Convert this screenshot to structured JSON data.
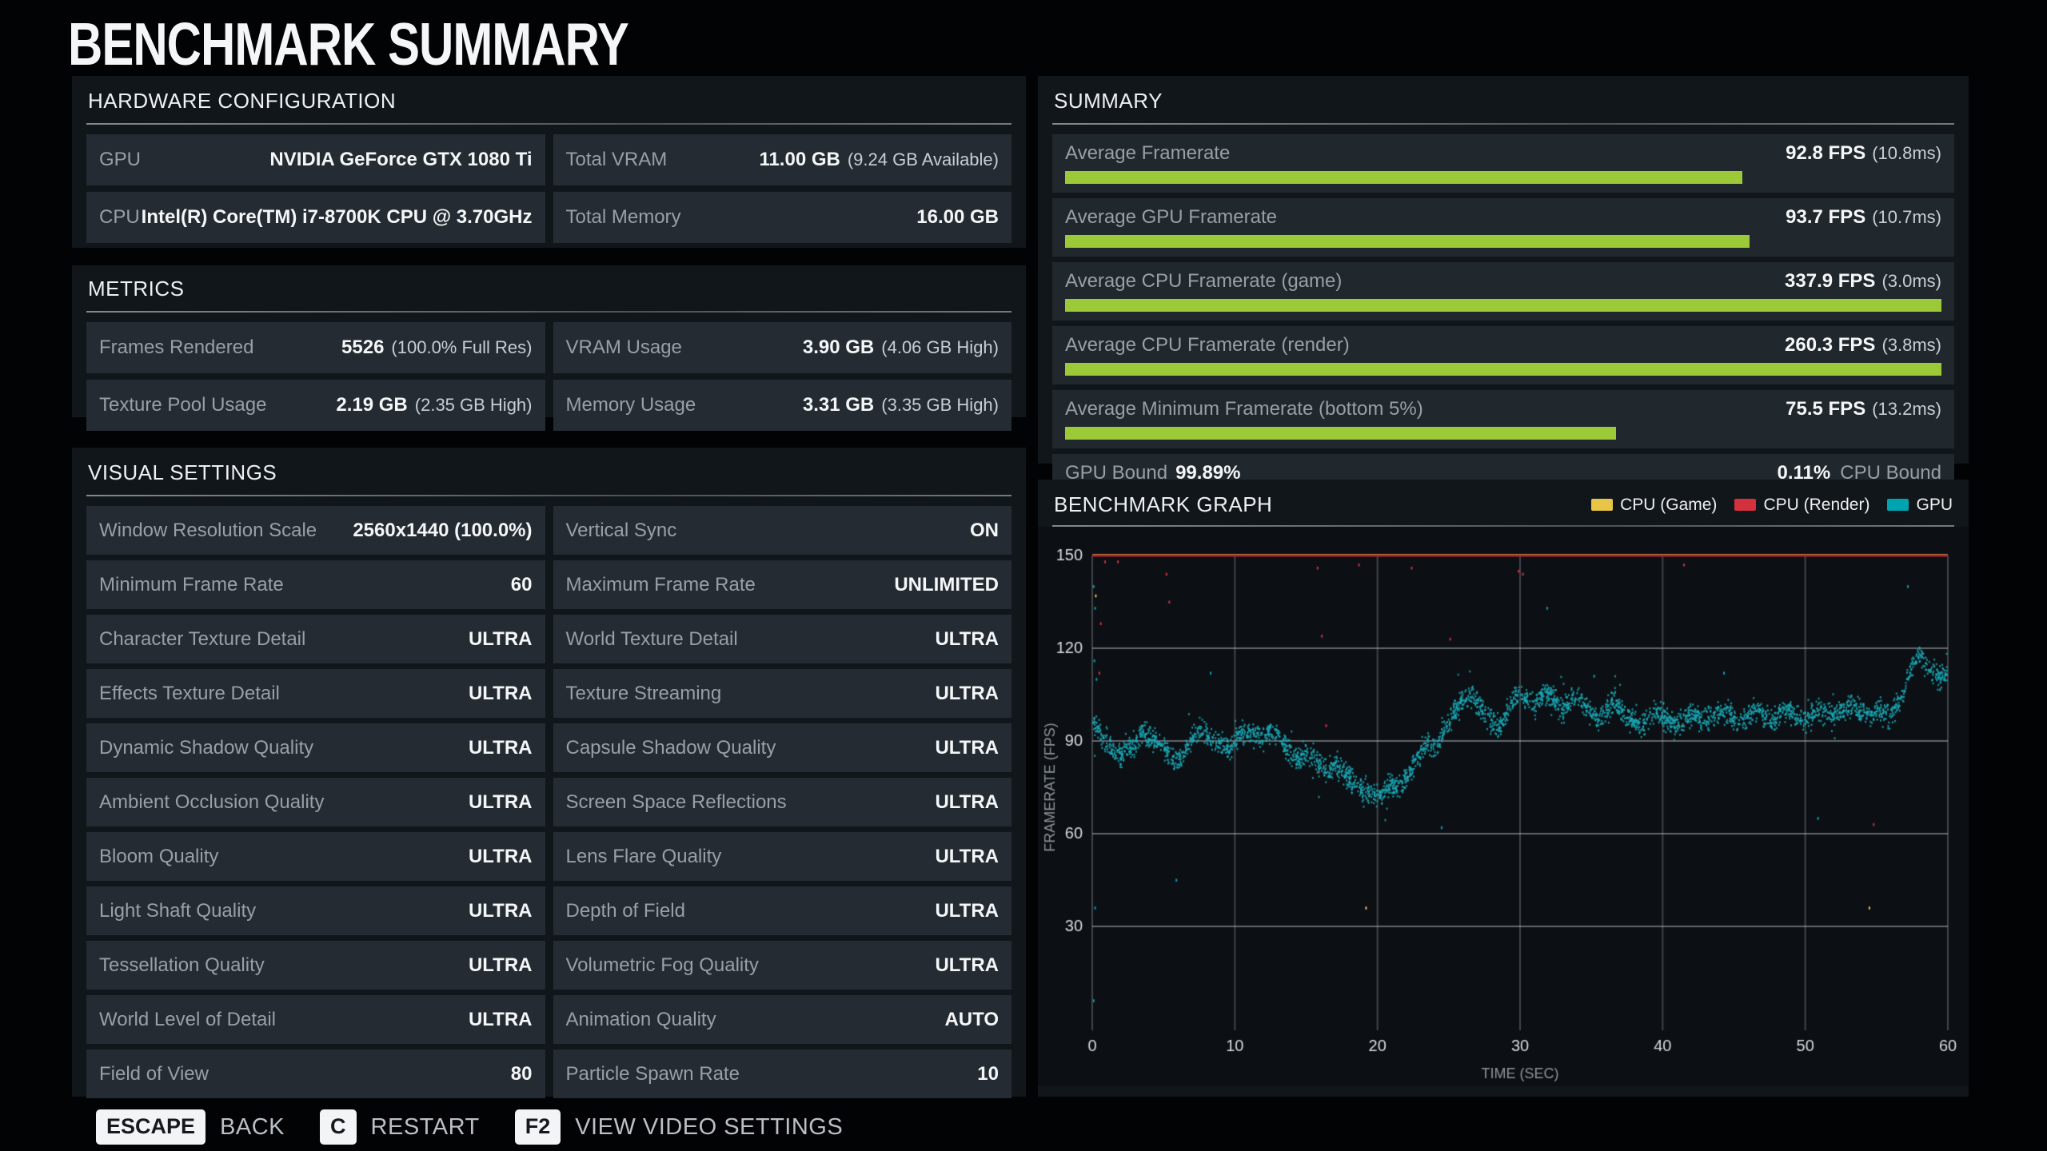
{
  "title": "BENCHMARK SUMMARY",
  "colors": {
    "green": "#9cc938",
    "cyan": "#00a3b0",
    "red": "#c2303c",
    "yellow": "#e8c547",
    "scatter_teal": "#1aa9b6",
    "red_line": "#a92733"
  },
  "hardware": {
    "heading": "HARDWARE CONFIGURATION",
    "rows": [
      {
        "label": "GPU",
        "value": "NVIDIA GeForce GTX 1080 Ti",
        "note": ""
      },
      {
        "label": "Total VRAM",
        "value": "11.00 GB",
        "note": "(9.24 GB Available)"
      },
      {
        "label": "CPU",
        "value": "Intel(R) Core(TM) i7-8700K CPU @ 3.70GHz",
        "note": ""
      },
      {
        "label": "Total Memory",
        "value": "16.00 GB",
        "note": ""
      }
    ]
  },
  "metrics": {
    "heading": "METRICS",
    "rows": [
      {
        "label": "Frames Rendered",
        "value": "5526",
        "note": "(100.0% Full Res)"
      },
      {
        "label": "VRAM Usage",
        "value": "3.90 GB",
        "note": "(4.06 GB High)"
      },
      {
        "label": "Texture Pool Usage",
        "value": "2.19 GB",
        "note": "(2.35 GB High)"
      },
      {
        "label": "Memory Usage",
        "value": "3.31 GB",
        "note": "(3.35 GB High)"
      }
    ]
  },
  "settings": {
    "heading": "VISUAL SETTINGS",
    "rows": [
      {
        "label": "Window Resolution Scale",
        "value": "2560x1440 (100.0%)",
        "note": ""
      },
      {
        "label": "Vertical Sync",
        "value": "ON",
        "note": ""
      },
      {
        "label": "Minimum Frame Rate",
        "value": "60",
        "note": ""
      },
      {
        "label": "Maximum Frame Rate",
        "value": "UNLIMITED",
        "note": ""
      },
      {
        "label": "Character Texture Detail",
        "value": "ULTRA",
        "note": ""
      },
      {
        "label": "World Texture Detail",
        "value": "ULTRA",
        "note": ""
      },
      {
        "label": "Effects Texture Detail",
        "value": "ULTRA",
        "note": ""
      },
      {
        "label": "Texture Streaming",
        "value": "ULTRA",
        "note": ""
      },
      {
        "label": "Dynamic Shadow Quality",
        "value": "ULTRA",
        "note": ""
      },
      {
        "label": "Capsule Shadow Quality",
        "value": "ULTRA",
        "note": ""
      },
      {
        "label": "Ambient Occlusion Quality",
        "value": "ULTRA",
        "note": ""
      },
      {
        "label": "Screen Space Reflections",
        "value": "ULTRA",
        "note": ""
      },
      {
        "label": "Bloom Quality",
        "value": "ULTRA",
        "note": ""
      },
      {
        "label": "Lens Flare Quality",
        "value": "ULTRA",
        "note": ""
      },
      {
        "label": "Light Shaft Quality",
        "value": "ULTRA",
        "note": ""
      },
      {
        "label": "Depth of Field",
        "value": "ULTRA",
        "note": ""
      },
      {
        "label": "Tessellation Quality",
        "value": "ULTRA",
        "note": ""
      },
      {
        "label": "Volumetric Fog Quality",
        "value": "ULTRA",
        "note": ""
      },
      {
        "label": "World Level of Detail",
        "value": "ULTRA",
        "note": ""
      },
      {
        "label": "Animation Quality",
        "value": "AUTO",
        "note": ""
      },
      {
        "label": "Field of View",
        "value": "80",
        "note": ""
      },
      {
        "label": "Particle Spawn Rate",
        "value": "10",
        "note": ""
      }
    ]
  },
  "summary": {
    "heading": "SUMMARY",
    "rows": [
      {
        "label": "Average Framerate",
        "value": "92.8 FPS",
        "note": "(10.8ms)",
        "bar_pct": 77.3
      },
      {
        "label": "Average GPU Framerate",
        "value": "93.7 FPS",
        "note": "(10.7ms)",
        "bar_pct": 78.1
      },
      {
        "label": "Average CPU Framerate (game)",
        "value": "337.9 FPS",
        "note": "(3.0ms)",
        "bar_pct": 100
      },
      {
        "label": "Average CPU Framerate (render)",
        "value": "260.3 FPS",
        "note": "(3.8ms)",
        "bar_pct": 100
      },
      {
        "label": "Average Minimum Framerate (bottom 5%)",
        "value": "75.5 FPS",
        "note": "(13.2ms)",
        "bar_pct": 62.9
      }
    ],
    "gpu_bound": {
      "left_label": "GPU Bound",
      "left_value": "99.89%",
      "right_value": "0.11%",
      "right_label": "CPU Bound",
      "gpu_pct": 99.89,
      "cpu_pct": 0.11
    }
  },
  "chart_data": {
    "type": "scatter",
    "title": "BENCHMARK GRAPH",
    "xlabel": "TIME (SEC)",
    "ylabel": "FRAMERATE (FPS)",
    "xlim": [
      0,
      60
    ],
    "ylim": [
      0,
      150
    ],
    "xticks": [
      0,
      10,
      20,
      30,
      40,
      50,
      60
    ],
    "yticks": [
      150,
      120,
      90,
      60,
      30
    ],
    "grid": true,
    "legend_position": "top-right",
    "legend": [
      {
        "name": "CPU (Game)",
        "color": "#e8c547"
      },
      {
        "name": "CPU (Render)",
        "color": "#d4303e"
      },
      {
        "name": "GPU",
        "color": "#00a3b0"
      }
    ],
    "series": [
      {
        "name": "CPU (Game)",
        "avg_fps": 337.9,
        "render": "clipped-line",
        "line_y": 150,
        "outliers": [
          [
            0.25,
            137
          ],
          [
            19.2,
            36
          ],
          [
            54.5,
            36
          ]
        ]
      },
      {
        "name": "CPU (Render)",
        "avg_fps": 260.3,
        "render": "clipped-line",
        "line_y": 150,
        "outliers": [
          [
            0.9,
            148
          ],
          [
            1.8,
            148
          ],
          [
            5.2,
            144
          ],
          [
            5.4,
            135
          ],
          [
            15.8,
            146
          ],
          [
            16.1,
            124
          ],
          [
            16.4,
            95
          ],
          [
            15.9,
            80
          ],
          [
            18.7,
            147
          ],
          [
            22.1,
            78
          ],
          [
            22.4,
            146
          ],
          [
            25.1,
            123
          ],
          [
            29.9,
            145
          ],
          [
            30.2,
            144
          ],
          [
            41.5,
            147
          ],
          [
            54.8,
            63
          ],
          [
            0.6,
            128
          ],
          [
            0.5,
            112
          ]
        ]
      },
      {
        "name": "GPU",
        "avg_fps": 93.7,
        "render": "scatter-band",
        "band_jitter": 5.5,
        "control_points": [
          [
            0,
            96
          ],
          [
            0.5,
            93
          ],
          [
            1,
            90
          ],
          [
            1.5,
            87
          ],
          [
            2,
            85
          ],
          [
            3,
            89
          ],
          [
            3.5,
            93
          ],
          [
            4,
            91
          ],
          [
            5,
            88
          ],
          [
            5.5,
            85
          ],
          [
            6,
            83
          ],
          [
            7,
            91
          ],
          [
            7.5,
            94
          ],
          [
            8,
            92
          ],
          [
            9,
            89
          ],
          [
            9.5,
            87
          ],
          [
            10,
            90
          ],
          [
            10.5,
            93
          ],
          [
            11,
            92
          ],
          [
            12,
            91
          ],
          [
            12.5,
            93
          ],
          [
            13,
            92
          ],
          [
            13.5,
            89
          ],
          [
            14,
            86
          ],
          [
            14.5,
            84
          ],
          [
            15,
            87
          ],
          [
            15.5,
            85
          ],
          [
            16,
            82
          ],
          [
            16.5,
            80
          ],
          [
            17,
            83
          ],
          [
            17.5,
            81
          ],
          [
            18,
            78
          ],
          [
            18.5,
            76
          ],
          [
            19,
            74
          ],
          [
            19.5,
            73
          ],
          [
            20,
            72
          ],
          [
            20.5,
            74
          ],
          [
            21,
            76
          ],
          [
            21.5,
            75
          ],
          [
            22,
            78
          ],
          [
            22.5,
            82
          ],
          [
            23,
            86
          ],
          [
            23.5,
            90
          ],
          [
            24,
            88
          ],
          [
            24.5,
            92
          ],
          [
            25,
            96
          ],
          [
            25.5,
            100
          ],
          [
            26,
            103
          ],
          [
            26.5,
            105
          ],
          [
            27,
            102
          ],
          [
            27.5,
            99
          ],
          [
            28,
            96
          ],
          [
            28.5,
            94
          ],
          [
            29,
            98
          ],
          [
            29.5,
            103
          ],
          [
            30,
            106
          ],
          [
            30.5,
            104
          ],
          [
            31,
            101
          ],
          [
            31.5,
            104
          ],
          [
            32,
            106
          ],
          [
            32.5,
            103
          ],
          [
            33,
            100
          ],
          [
            33.5,
            103
          ],
          [
            34,
            105
          ],
          [
            34.5,
            102
          ],
          [
            35,
            99
          ],
          [
            35.5,
            97
          ],
          [
            36,
            100
          ],
          [
            36.5,
            102
          ],
          [
            37,
            100
          ],
          [
            37.5,
            98
          ],
          [
            38,
            96
          ],
          [
            38.5,
            95
          ],
          [
            39,
            97
          ],
          [
            39.5,
            99
          ],
          [
            40,
            98
          ],
          [
            40.5,
            96
          ],
          [
            41,
            95
          ],
          [
            41.5,
            97
          ],
          [
            42,
            99
          ],
          [
            42.5,
            98
          ],
          [
            43,
            96
          ],
          [
            43.5,
            98
          ],
          [
            44,
            100
          ],
          [
            44.5,
            99
          ],
          [
            45,
            97
          ],
          [
            45.5,
            96
          ],
          [
            46,
            98
          ],
          [
            46.5,
            100
          ],
          [
            47,
            99
          ],
          [
            47.5,
            97
          ],
          [
            48,
            98
          ],
          [
            48.5,
            100
          ],
          [
            49,
            99
          ],
          [
            49.5,
            98
          ],
          [
            50,
            97
          ],
          [
            50.5,
            99
          ],
          [
            51,
            100
          ],
          [
            51.5,
            99
          ],
          [
            52,
            98
          ],
          [
            52.5,
            100
          ],
          [
            53,
            101
          ],
          [
            53.5,
            100
          ],
          [
            54,
            99
          ],
          [
            54.5,
            98
          ],
          [
            55,
            100
          ],
          [
            55.5,
            99
          ],
          [
            56,
            98
          ],
          [
            56.5,
            102
          ],
          [
            57,
            108
          ],
          [
            57.5,
            114
          ],
          [
            58,
            118
          ],
          [
            58.5,
            115
          ],
          [
            59,
            112
          ],
          [
            59.5,
            110
          ],
          [
            60,
            113
          ]
        ],
        "outliers": [
          [
            0.1,
            140
          ],
          [
            0.2,
            133
          ],
          [
            0.15,
            116
          ],
          [
            0.3,
            110
          ],
          [
            8.3,
            112
          ],
          [
            31.9,
            133
          ],
          [
            35.2,
            111
          ],
          [
            44.3,
            112
          ],
          [
            57.2,
            140
          ],
          [
            0.2,
            36
          ],
          [
            0.1,
            6
          ],
          [
            24.5,
            62
          ],
          [
            50.9,
            65
          ],
          [
            5.9,
            45
          ]
        ]
      }
    ]
  },
  "key_bar": [
    {
      "key": "ESCAPE",
      "label": "BACK"
    },
    {
      "key": "C",
      "label": "RESTART"
    },
    {
      "key": "F2",
      "label": "VIEW VIDEO SETTINGS"
    }
  ]
}
